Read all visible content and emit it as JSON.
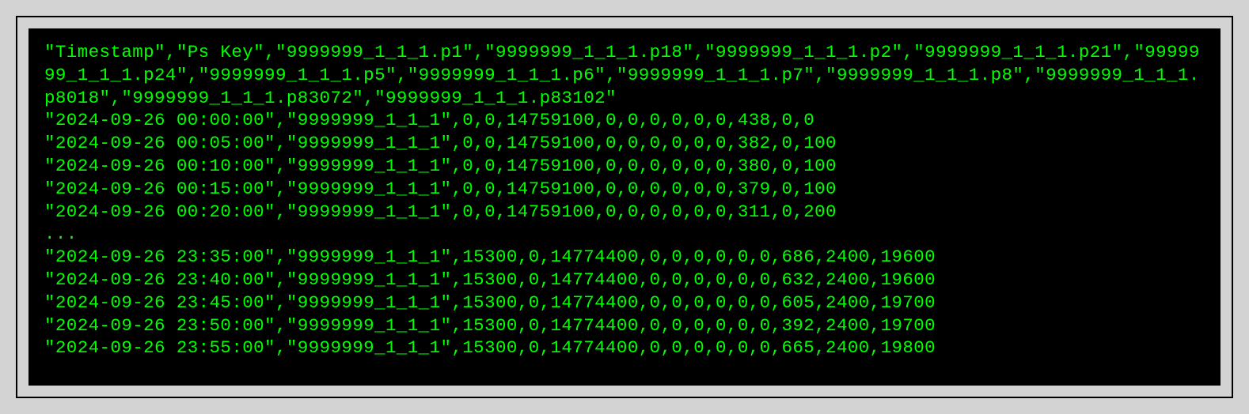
{
  "terminal": {
    "header_line": "\"Timestamp\",\"Ps Key\",\"9999999_1_1_1.p1\",\"9999999_1_1_1.p18\",\"9999999_1_1_1.p2\",\"9999999_1_1_1.p21\",\"9999999_1_1_1.p24\",\"9999999_1_1_1.p5\",\"9999999_1_1_1.p6\",\"9999999_1_1_1.p7\",\"9999999_1_1_1.p8\",\"9999999_1_1_1.p8018\",\"9999999_1_1_1.p83072\",\"9999999_1_1_1.p83102\"",
    "rows_top": [
      "\"2024-09-26 00:00:00\",\"9999999_1_1_1\",0,0,14759100,0,0,0,0,0,0,438,0,0",
      "\"2024-09-26 00:05:00\",\"9999999_1_1_1\",0,0,14759100,0,0,0,0,0,0,382,0,100",
      "\"2024-09-26 00:10:00\",\"9999999_1_1_1\",0,0,14759100,0,0,0,0,0,0,380,0,100",
      "\"2024-09-26 00:15:00\",\"9999999_1_1_1\",0,0,14759100,0,0,0,0,0,0,379,0,100",
      "\"2024-09-26 00:20:00\",\"9999999_1_1_1\",0,0,14759100,0,0,0,0,0,0,311,0,200"
    ],
    "ellipsis": "...",
    "rows_bottom": [
      "\"2024-09-26 23:35:00\",\"9999999_1_1_1\",15300,0,14774400,0,0,0,0,0,0,686,2400,19600",
      "\"2024-09-26 23:40:00\",\"9999999_1_1_1\",15300,0,14774400,0,0,0,0,0,0,632,2400,19600",
      "\"2024-09-26 23:45:00\",\"9999999_1_1_1\",15300,0,14774400,0,0,0,0,0,0,605,2400,19700",
      "\"2024-09-26 23:50:00\",\"9999999_1_1_1\",15300,0,14774400,0,0,0,0,0,0,392,2400,19700",
      "\"2024-09-26 23:55:00\",\"9999999_1_1_1\",15300,0,14774400,0,0,0,0,0,0,665,2400,19800"
    ]
  }
}
